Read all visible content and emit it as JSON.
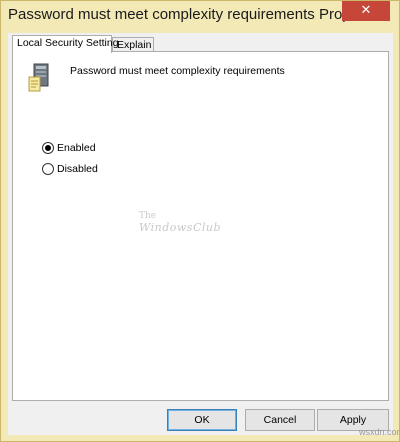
{
  "window": {
    "title": "Password must meet complexity requirements Prope...",
    "close_glyph": "✕"
  },
  "tabs": [
    {
      "label": "Local Security Setting",
      "active": true
    },
    {
      "label": "Explain",
      "active": false
    }
  ],
  "policy": {
    "icon": "server-policy-icon",
    "title": "Password must meet complexity requirements"
  },
  "options": [
    {
      "label": "Enabled",
      "checked": true
    },
    {
      "label": "Disabled",
      "checked": false
    }
  ],
  "watermark": {
    "line1": "The",
    "line2": "WindowsClub"
  },
  "buttons": {
    "ok": "OK",
    "cancel": "Cancel",
    "apply": "Apply"
  },
  "credit": "wsxdn.com",
  "colors": {
    "titlebar": "#f3e9b6",
    "close": "#c7463a",
    "dialog": "#f0f0f0"
  }
}
